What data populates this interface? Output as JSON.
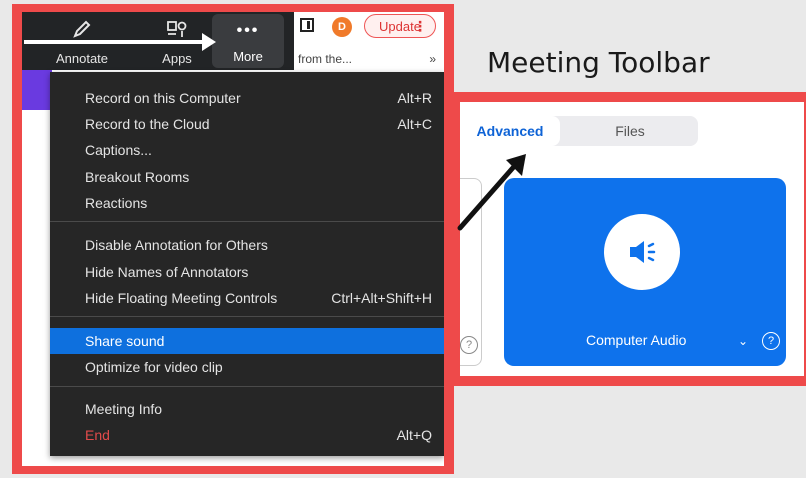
{
  "toolbar": {
    "annotate_label": "Annotate",
    "apps_label": "Apps",
    "more_label": "More",
    "more_icon": "•••",
    "avatar_initial": "D",
    "update_label": "Update",
    "browser_text": "from the...",
    "browser_chevron": "»"
  },
  "menu": {
    "items": [
      {
        "label": "Record on this Computer",
        "shortcut": "Alt+R"
      },
      {
        "label": "Record to the Cloud",
        "shortcut": "Alt+C"
      },
      {
        "label": "Captions...",
        "shortcut": ""
      },
      {
        "label": "Breakout Rooms",
        "shortcut": ""
      },
      {
        "label": "Reactions",
        "shortcut": ""
      },
      {
        "label": "Disable Annotation for Others",
        "shortcut": ""
      },
      {
        "label": "Hide Names of Annotators",
        "shortcut": ""
      },
      {
        "label": "Hide Floating Meeting Controls",
        "shortcut": "Ctrl+Alt+Shift+H"
      },
      {
        "label": "Share sound",
        "shortcut": ""
      },
      {
        "label": "Optimize for video clip",
        "shortcut": ""
      },
      {
        "label": "Meeting Info",
        "shortcut": ""
      },
      {
        "label": "End",
        "shortcut": "Alt+Q"
      }
    ]
  },
  "right_panel": {
    "title": "Meeting Toolbar",
    "tab_advanced": "Advanced",
    "tab_files": "Files",
    "audio_label": "Computer Audio",
    "chevron": "⌄",
    "help": "?"
  },
  "colors": {
    "frame_red": "#ee4a4a",
    "menu_bg": "#262626",
    "active_blue": "#0e70de",
    "card_blue": "#0e72ec",
    "end_red": "#e34b4b"
  }
}
